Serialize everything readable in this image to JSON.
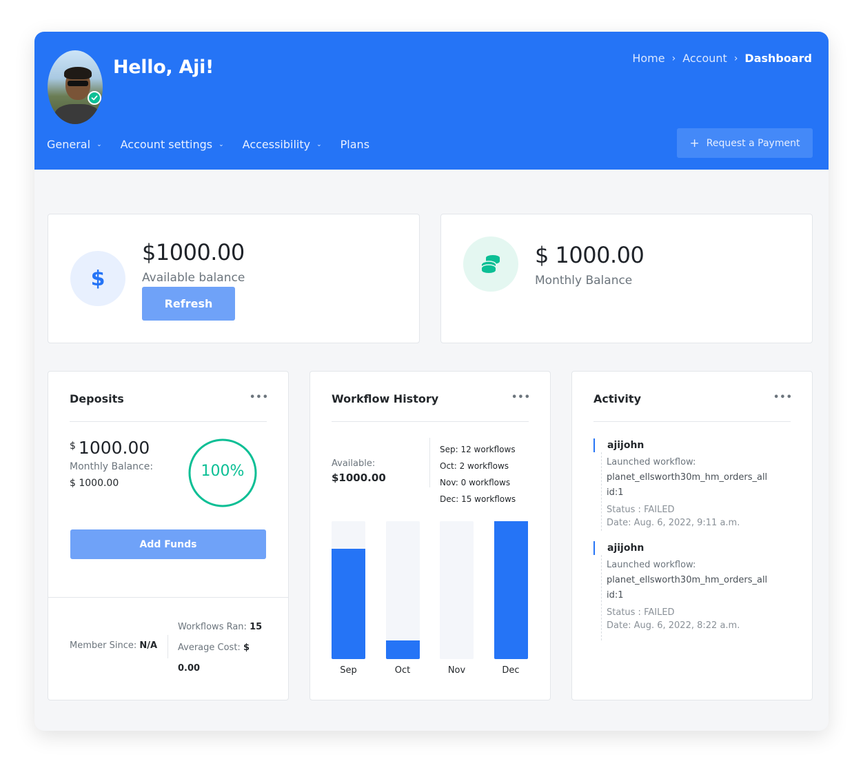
{
  "header": {
    "greeting": "Hello, Aji!",
    "breadcrumb": [
      "Home",
      "Account",
      "Dashboard"
    ],
    "nav": [
      {
        "label": "General",
        "has_dropdown": true
      },
      {
        "label": "Account settings",
        "has_dropdown": true
      },
      {
        "label": "Accessibility",
        "has_dropdown": true
      },
      {
        "label": "Plans",
        "has_dropdown": false
      }
    ],
    "request_button": "Request a Payment",
    "request_icon": "plus-icon"
  },
  "balance_card": {
    "icon": "dollar-icon",
    "amount": "$1000.00",
    "label": "Available balance",
    "refresh_label": "Refresh"
  },
  "monthly_card": {
    "icon": "coins-icon",
    "amount": "$ 1000.00",
    "label": "Monthly Balance"
  },
  "deposits": {
    "title": "Deposits",
    "currency": "$",
    "amount": "1000.00",
    "monthly_label": "Monthly Balance:",
    "monthly_value": "$ 1000.00",
    "progress_text": "100%",
    "progress_fraction": 1.0,
    "add_funds_label": "Add Funds",
    "member_since_label": "Member Since:",
    "member_since_value": "N/A",
    "workflows_ran_label": "Workflows Ran:",
    "workflows_ran_value": "15",
    "average_cost_label": "Average Cost:",
    "average_cost_currency": "$",
    "average_cost_value": "0.00"
  },
  "workflow_history": {
    "title": "Workflow History",
    "available_label": "Available:",
    "available_value": "$1000.00",
    "legend": [
      "Sep: 12 workflows",
      "Oct: 2 workflows",
      "Nov: 0 workflows",
      "Dec: 15 workflows"
    ]
  },
  "chart_data": {
    "type": "bar",
    "categories": [
      "Sep",
      "Oct",
      "Nov",
      "Dec"
    ],
    "values": [
      12,
      2,
      0,
      15
    ],
    "ylim": [
      0,
      15
    ]
  },
  "activity": {
    "title": "Activity",
    "entries": [
      {
        "user": "ajijohn",
        "action": "Launched workflow:",
        "workflow": "planet_ellsworth30m_hm_orders_all",
        "id": "id:1",
        "status": "Status : FAILED",
        "date": "Date: Aug. 6, 2022, 9:11 a.m."
      },
      {
        "user": "ajijohn",
        "action": "Launched workflow:",
        "workflow": "planet_ellsworth30m_hm_orders_all",
        "id": "id:1",
        "status": "Status : FAILED",
        "date": "Date: Aug. 6, 2022, 8:22 a.m."
      }
    ]
  },
  "colors": {
    "primary": "#2574f6",
    "success": "#0bbf95",
    "button_light": "#6fa2f8"
  }
}
